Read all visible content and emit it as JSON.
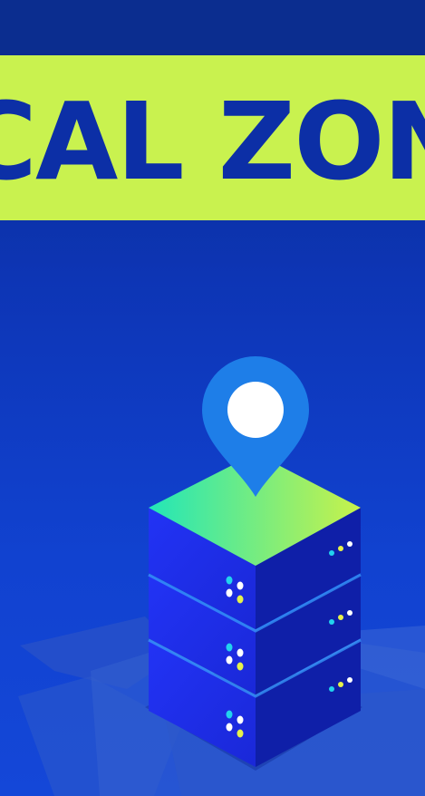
{
  "banner": {
    "title": "LOCAL ZONES"
  },
  "colors": {
    "background_top": "#0a2a8a",
    "background_bottom": "#1447d8",
    "banner": "#c9f24f",
    "banner_text": "#0c2fa6",
    "server_face_left": "#1e2ef0",
    "server_face_right": "#0f1fa8",
    "server_top_from": "#22e6b8",
    "server_top_to": "#c8f24a",
    "pin": "#1e7ee8",
    "led_cyan": "#22d3ee",
    "led_yellow": "#e6f24a"
  },
  "icons": [
    "location-pin-icon",
    "server-stack-icon"
  ]
}
